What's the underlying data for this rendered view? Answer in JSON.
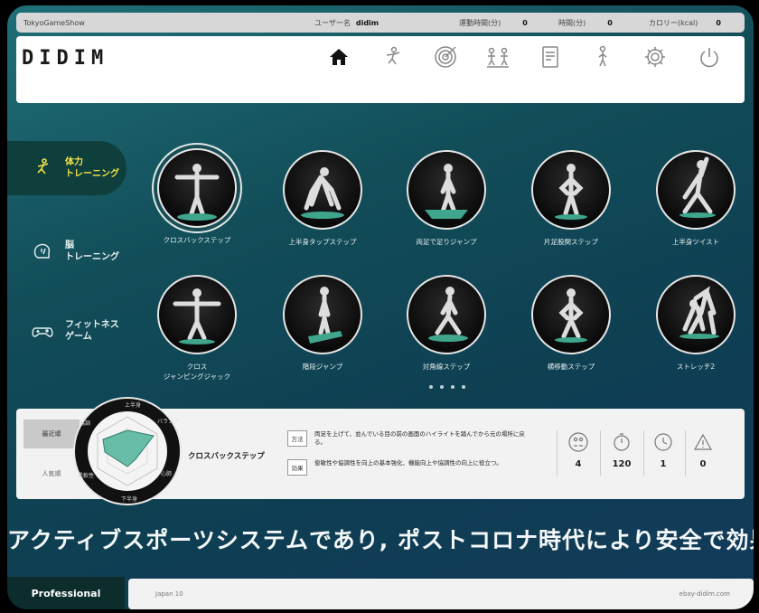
{
  "statusbar": {
    "app_name": "TokyoGameShow",
    "user_label": "ユーザー名",
    "user_value": "didim",
    "field2_label": "運動時間(分)",
    "field2_value": "0",
    "field3_label": "時間(分)",
    "field3_value": "0",
    "field4_label": "カロリー(kcal)",
    "field4_value": "0"
  },
  "header": {
    "logo": "DIDIM",
    "nav_icons": [
      "home-icon",
      "training-icon",
      "target-icon",
      "versus-icon",
      "report-icon",
      "figure-icon",
      "gear-icon",
      "power-icon"
    ]
  },
  "sidebar": {
    "items": [
      {
        "icon": "runner-icon",
        "label_line1": "体力",
        "label_line2": "トレーニング",
        "active": true
      },
      {
        "icon": "brain-icon",
        "label_line1": "脳",
        "label_line2": "トレーニング",
        "active": false
      },
      {
        "icon": "gamepad-icon",
        "label_line1": "フィットネス",
        "label_line2": "ゲーム",
        "active": false
      }
    ]
  },
  "exercises": [
    {
      "label": "クロスバックステップ",
      "pose": "tpose",
      "selected": true
    },
    {
      "label": "上半身タップステップ",
      "pose": "crouch"
    },
    {
      "label": "両足で足りジャンプ",
      "pose": "stand"
    },
    {
      "label": "片足股関ステップ",
      "pose": "hips"
    },
    {
      "label": "上半身ツイスト",
      "pose": "lean"
    },
    {
      "label": "クロス",
      "label2": "ジャンピングジャック",
      "pose": "tpose"
    },
    {
      "label": "階段ジャンプ",
      "pose": "stand"
    },
    {
      "label": "対角線ステップ",
      "pose": "step"
    },
    {
      "label": "横移動ステップ",
      "pose": "hips"
    },
    {
      "label": "ストレッチ2",
      "pose": "bend"
    }
  ],
  "info": {
    "tab_recent": "最近順",
    "tab_popular": "人気順",
    "radar_labels": [
      "上半身",
      "バランス",
      "心肺",
      "下半身",
      "柔軟性",
      "協調"
    ],
    "title": "クロスバックステップ",
    "tag1": "方法",
    "desc1": "両足を上げて、並んでいる目の前の画面のハイライトを踏んでから元の場所に戻る。",
    "tag2": "効果",
    "desc2": "俊敏性や協調性を向上の基本強化、機能向上や協調性の向上に役立つ。",
    "stats": [
      {
        "icon": "players-icon",
        "value": "4"
      },
      {
        "icon": "timer-icon",
        "value": "120"
      },
      {
        "icon": "clock-icon",
        "value": "1"
      },
      {
        "icon": "warning-icon",
        "value": "0"
      }
    ]
  },
  "marquee": "アクティブスポーツシステムであり, ポストコロナ時代により安全で効果的な室",
  "footer": {
    "mode": "Professional",
    "left_text": "Japan 10",
    "right_text": "ebay-didim.com"
  },
  "colors": {
    "bg_teal": "#1f6f78",
    "active_label": "#f1e24a",
    "radar_fill": "#4fb39a"
  }
}
